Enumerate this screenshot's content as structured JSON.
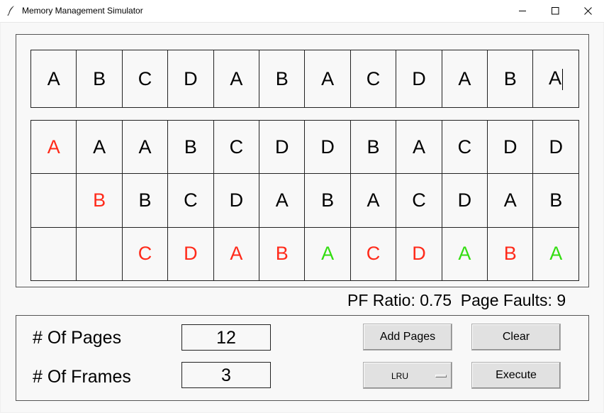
{
  "window": {
    "title": "Memory Management Simulator",
    "icon": "feather-icon",
    "controls": [
      "minimize-icon",
      "maximize-icon",
      "close-icon"
    ]
  },
  "reference_string": [
    "A",
    "B",
    "C",
    "D",
    "A",
    "B",
    "A",
    "C",
    "D",
    "A",
    "B",
    "A"
  ],
  "frames": [
    [
      {
        "v": "A",
        "s": "fault"
      },
      {
        "v": "A",
        "s": "normal"
      },
      {
        "v": "A",
        "s": "normal"
      },
      {
        "v": "B",
        "s": "normal"
      },
      {
        "v": "C",
        "s": "normal"
      },
      {
        "v": "D",
        "s": "normal"
      },
      {
        "v": "D",
        "s": "normal"
      },
      {
        "v": "B",
        "s": "normal"
      },
      {
        "v": "A",
        "s": "normal"
      },
      {
        "v": "C",
        "s": "normal"
      },
      {
        "v": "D",
        "s": "normal"
      },
      {
        "v": "D",
        "s": "normal"
      }
    ],
    [
      {
        "v": "",
        "s": "normal"
      },
      {
        "v": "B",
        "s": "fault"
      },
      {
        "v": "B",
        "s": "normal"
      },
      {
        "v": "C",
        "s": "normal"
      },
      {
        "v": "D",
        "s": "normal"
      },
      {
        "v": "A",
        "s": "normal"
      },
      {
        "v": "B",
        "s": "normal"
      },
      {
        "v": "A",
        "s": "normal"
      },
      {
        "v": "C",
        "s": "normal"
      },
      {
        "v": "D",
        "s": "normal"
      },
      {
        "v": "A",
        "s": "normal"
      },
      {
        "v": "B",
        "s": "normal"
      }
    ],
    [
      {
        "v": "",
        "s": "normal"
      },
      {
        "v": "",
        "s": "normal"
      },
      {
        "v": "C",
        "s": "fault"
      },
      {
        "v": "D",
        "s": "fault"
      },
      {
        "v": "A",
        "s": "fault"
      },
      {
        "v": "B",
        "s": "fault"
      },
      {
        "v": "A",
        "s": "hit"
      },
      {
        "v": "C",
        "s": "fault"
      },
      {
        "v": "D",
        "s": "fault"
      },
      {
        "v": "A",
        "s": "hit"
      },
      {
        "v": "B",
        "s": "fault"
      },
      {
        "v": "A",
        "s": "hit"
      }
    ]
  ],
  "colors": {
    "fault": "#ff2a1a",
    "hit": "#33dd11",
    "text": "#000000"
  },
  "stats": {
    "text": "PF Ratio: 0.75  Page Faults: 9"
  },
  "controls": {
    "pages_label": "# Of Pages",
    "pages_value": "12",
    "frames_label": "# Of Frames",
    "frames_value": "3",
    "add_pages": "Add Pages",
    "clear": "Clear",
    "algorithm": "LRU",
    "execute": "Execute"
  }
}
